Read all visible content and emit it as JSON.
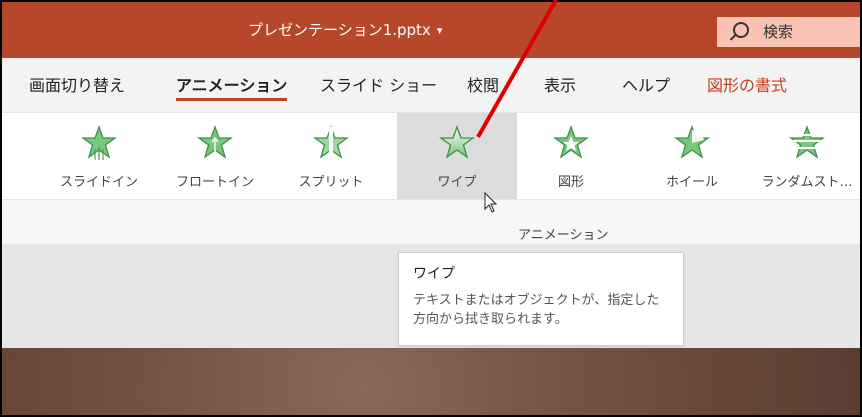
{
  "window": {
    "title": "プレゼンテーション1.pptx",
    "title_caret": "▾",
    "search_label": "検索"
  },
  "tabs": [
    {
      "label": "画面切り替え"
    },
    {
      "label": "アニメーション",
      "active": true
    },
    {
      "label": "スライド ショー"
    },
    {
      "label": "校閲"
    },
    {
      "label": "表示"
    },
    {
      "label": "ヘルプ"
    },
    {
      "label": "図形の書式",
      "accent": true
    }
  ],
  "gallery": {
    "group_label": "アニメーション",
    "items": [
      {
        "label": "スライドイン",
        "icon": "star-fly-in-icon"
      },
      {
        "label": "フロートイン",
        "icon": "star-float-in-icon"
      },
      {
        "label": "スプリット",
        "icon": "star-split-icon"
      },
      {
        "label": "ワイプ",
        "icon": "star-wipe-icon",
        "selected": true
      },
      {
        "label": "図形",
        "icon": "star-shape-icon"
      },
      {
        "label": "ホイール",
        "icon": "star-wheel-icon"
      },
      {
        "label": "ランダムスト…",
        "icon": "star-random-bars-icon"
      }
    ]
  },
  "tooltip": {
    "title": "ワイプ",
    "body": "テキストまたはオブジェクトが、指定した方向から拭き取られます。"
  },
  "colors": {
    "titlebar": "#b7472a",
    "accent": "#c43e1c",
    "annotation_arrow": "#e00000",
    "star_fill": "#79c67d",
    "star_stroke": "#3e8f48"
  }
}
